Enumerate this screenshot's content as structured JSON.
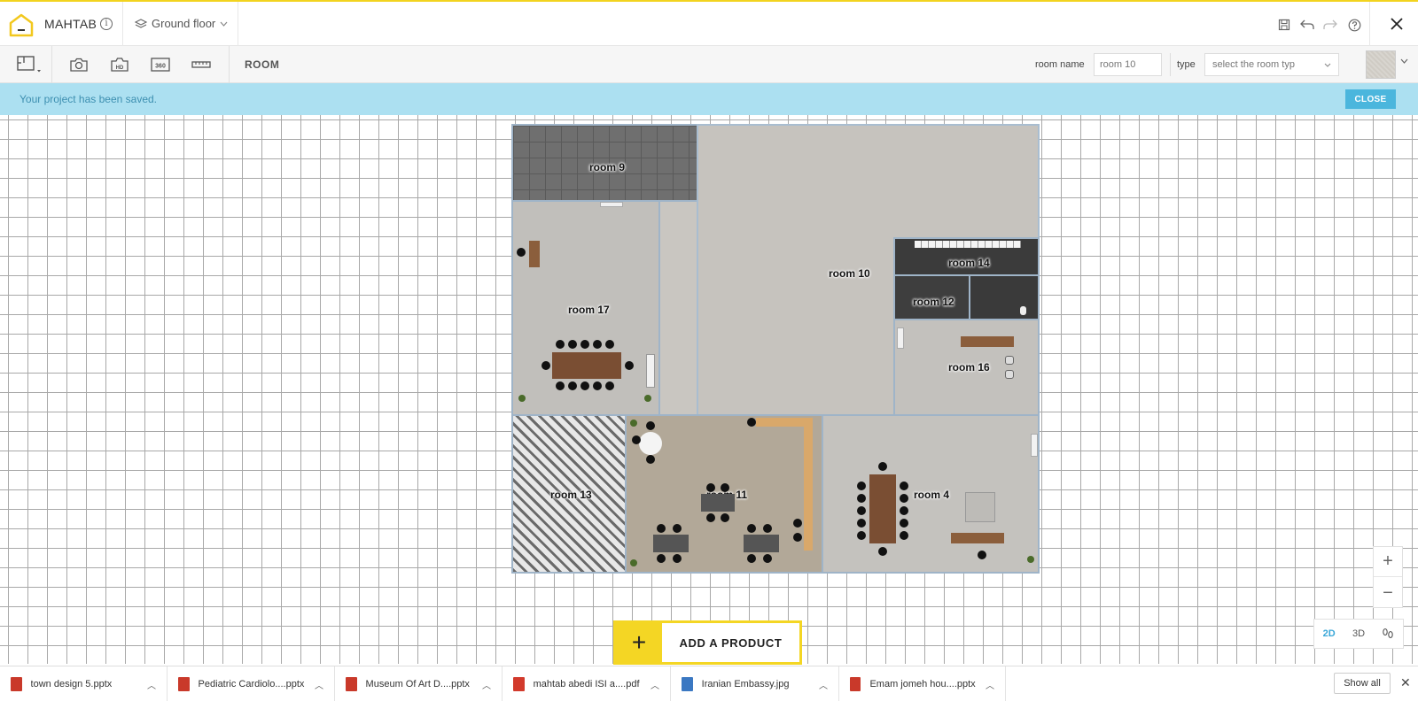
{
  "header": {
    "project_name": "MAHTAB",
    "floor": "Ground floor"
  },
  "toolbar": {
    "mode": "ROOM",
    "room_name_label": "room name",
    "room_name_value": "room 10",
    "type_label": "type",
    "type_placeholder": "select the room typ",
    "tool_360": "360",
    "tool_hd": "HD"
  },
  "notice": {
    "message": "Your project has been saved.",
    "close_label": "CLOSE"
  },
  "rooms": {
    "room9": "room 9",
    "room10": "room 10",
    "room14": "room 14",
    "room12": "room 12",
    "room17": "room 17",
    "room16": "room 16",
    "room13": "room 13",
    "room11": "room 11",
    "room4": "room 4"
  },
  "zoom": {
    "in": "+",
    "out": "−"
  },
  "views": {
    "d2": "2D",
    "d3": "3D"
  },
  "add_product": {
    "plus": "+",
    "label": "ADD A PRODUCT"
  },
  "downloads": {
    "items": [
      {
        "name": "town design 5.pptx",
        "kind": "pptx"
      },
      {
        "name": "Pediatric Cardiolo....pptx",
        "kind": "pptx"
      },
      {
        "name": "Museum Of Art D....pptx",
        "kind": "pptx"
      },
      {
        "name": "mahtab abedi ISI a....pdf",
        "kind": "pdf"
      },
      {
        "name": "Iranian Embassy.jpg",
        "kind": "jpg"
      },
      {
        "name": "Emam jomeh hou....pptx",
        "kind": "pptx"
      }
    ],
    "show_all": "Show all"
  },
  "colors": {
    "accent_yellow": "#f4d624",
    "notice_bg": "#ace0f1",
    "notice_button": "#4bb6dd",
    "active_view": "#3aa7d8",
    "wall": "#9fb4c8"
  }
}
